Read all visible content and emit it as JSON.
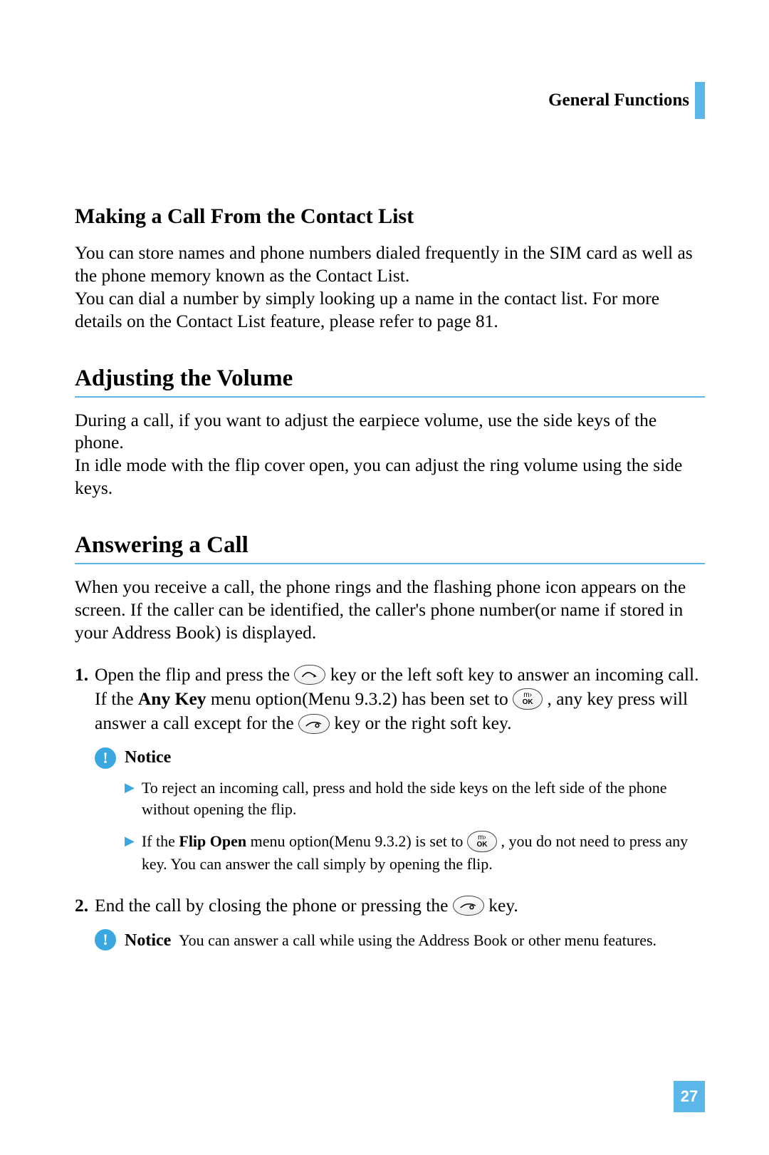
{
  "header": {
    "title": "General Functions"
  },
  "notice_label": "Notice",
  "page_number": "27",
  "sections": [
    {
      "heading": "Making a Call From the Contact List",
      "para1": "You can store names and phone numbers dialed frequently in the SIM card as well as the phone memory known as the Contact List.",
      "para2": "You can dial a number by simply looking up a name in the contact list. For more details on the Contact List feature, please refer to page 81."
    },
    {
      "heading": "Adjusting the Volume",
      "para1": "During a call, if you want to adjust the earpiece volume, use the side keys of the phone.",
      "para2": "In idle mode with the flip cover open, you can adjust the ring volume using the side keys."
    },
    {
      "heading": "Answering a Call",
      "para1": "When you receive a call, the phone rings and the flashing phone icon appears on the screen. If the caller can be identified, the caller's phone number(or name if stored in your Address Book) is displayed.",
      "steps": [
        {
          "num": "1.",
          "t1": "Open the flip and press the ",
          "t2": " key or the left soft key to answer an incoming call. If the ",
          "bold1": "Any Key",
          "t3": " menu option(Menu 9.3.2) has been set to ",
          "t4": " , any key press will answer a call except for the ",
          "t5": " key or the right soft key."
        },
        {
          "num": "2.",
          "t1": "End the call by closing the phone or pressing the ",
          "t2": " key."
        }
      ],
      "notice1": {
        "items": [
          "To reject an incoming call, press and hold the side keys on the left side of the phone without opening the flip."
        ],
        "item2": {
          "t1": "If the ",
          "bold": "Flip Open",
          "t2": " menu option(Menu 9.3.2) is set to ",
          "t3": " , you do not need to press any key. You can answer the call simply by opening the flip."
        }
      },
      "notice2": "You can answer a call while using the Address Book or other menu features."
    }
  ]
}
